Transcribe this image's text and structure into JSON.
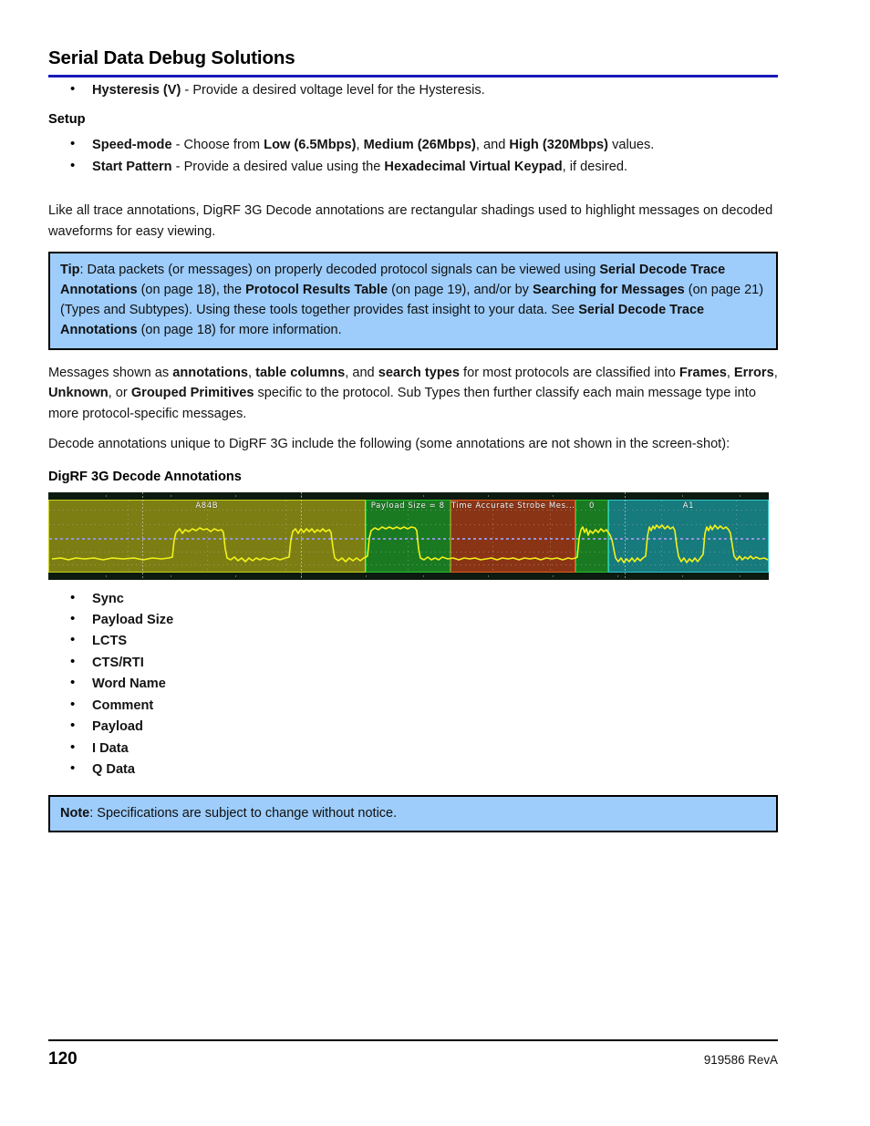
{
  "header": {
    "title": "Serial Data Debug Solutions",
    "rule_color": "#1a1ab8"
  },
  "intro_bullet": {
    "term": "Hysteresis (V)",
    "rest": " - Provide a desired voltage level for the Hysteresis."
  },
  "setup": {
    "heading": "Setup",
    "items": [
      {
        "term": "Speed-mode",
        "mid1": " - Choose from ",
        "opt1": "Low (6.5Mbps)",
        "sep1": ", ",
        "opt2": "Medium (26Mbps)",
        "sep2": ", and ",
        "opt3": "High (320Mbps)",
        "tail": " values."
      },
      {
        "term": "Start Pattern",
        "mid1": " - Provide a desired value using the ",
        "opt1": "Hexadecimal Virtual Keypad",
        "tail": ", if desired."
      }
    ]
  },
  "paragraphs": {
    "annotations_intro": "Like all trace annotations, DigRF 3G Decode annotations are rectangular shadings used to highlight messages on decoded waveforms for easy viewing.",
    "classification": {
      "t1": "Messages shown as ",
      "b1": "annotations",
      "t2": ", ",
      "b2": "table columns",
      "t3": ", and ",
      "b3": "search types",
      "t4": " for most protocols are classified into ",
      "b4": "Frames",
      "t5": ", ",
      "b5": "Errors",
      "t6": ", ",
      "b6": "Unknown",
      "t7": ", or ",
      "b7": "Grouped Primitives",
      "t8": " specific to the protocol. Sub Types then further classify each main message type into more protocol-specific messages."
    },
    "decode_intro": "Decode annotations unique to DigRF 3G include the following (some annotations are not shown in the screen-shot):"
  },
  "tip_box": {
    "label": "Tip",
    "t1": ": Data packets (or messages) on properly decoded protocol signals can be viewed using ",
    "b1": "Serial Decode Trace Annotations",
    "t2": " (on page 18), the ",
    "b2": "Protocol Results Table",
    "t3": " (on page 19), and/or by ",
    "b3": "Searching for Messages",
    "t4": " (on page 21) (Types and Subtypes). Using these tools together provides fast insight to your data. See ",
    "b4": "Serial Decode Trace Annotations",
    "t5": " (on page 18) for more information.",
    "background": "#9ecdfb",
    "border": "#000000"
  },
  "note_box": {
    "label": "Note",
    "text": ": Specifications are subject to change without notice.",
    "background": "#9ecdfb",
    "border": "#000000"
  },
  "figure": {
    "caption": "DigRF 3G Decode Annotations",
    "background": "#0d1a10",
    "trace_color": "#f2f21a",
    "segments": [
      {
        "label": "A84B",
        "fill": "#7c7e14",
        "border": "#c8d118",
        "left_pct": 0.0,
        "width_pct": 44.0
      },
      {
        "label": "Payload Size =   8",
        "fill": "#1a7a22",
        "border": "#25c22c",
        "left_pct": 44.0,
        "width_pct": 11.8
      },
      {
        "label": "Time Accurate Strobe Mes...",
        "fill": "#8a3416",
        "border": "#e0601e",
        "left_pct": 55.8,
        "width_pct": 17.4
      },
      {
        "label": "0",
        "fill": "#1a7a22",
        "border": "#25c22c",
        "left_pct": 73.2,
        "width_pct": 4.5
      },
      {
        "label": "A1",
        "fill": "#177a7d",
        "border": "#2ec8cc",
        "left_pct": 77.7,
        "width_pct": 22.3
      }
    ]
  },
  "annotation_list": {
    "items": [
      "Sync",
      "Payload Size",
      "LCTS",
      "CTS/RTI",
      "Word Name",
      "Comment",
      "Payload",
      "I Data",
      "Q Data"
    ]
  },
  "footer": {
    "page_number": "120",
    "document_id": "919586 RevA"
  }
}
